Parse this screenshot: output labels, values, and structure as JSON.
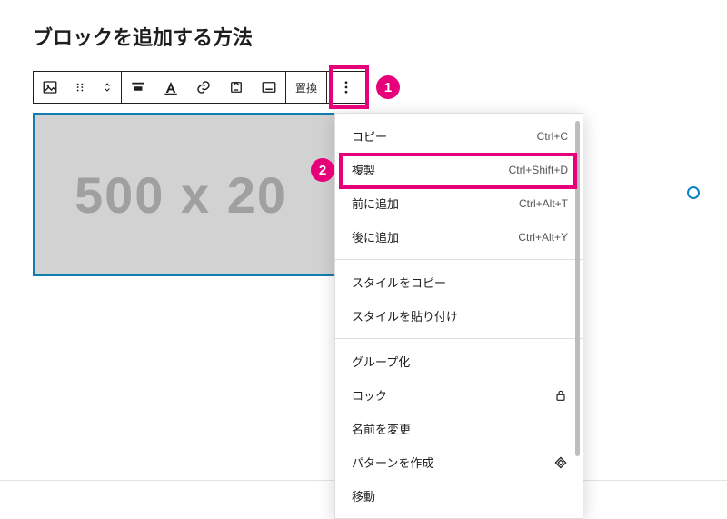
{
  "heading": "ブロックを追加する方法",
  "toolbar": {
    "replace_label": "置換"
  },
  "image_placeholder": "500 x 20",
  "callouts": {
    "one": "1",
    "two": "2"
  },
  "menu": {
    "group1": [
      {
        "label": "コピー",
        "shortcut": "Ctrl+C"
      },
      {
        "label": "複製",
        "shortcut": "Ctrl+Shift+D"
      },
      {
        "label": "前に追加",
        "shortcut": "Ctrl+Alt+T"
      },
      {
        "label": "後に追加",
        "shortcut": "Ctrl+Alt+Y"
      }
    ],
    "group2": [
      {
        "label": "スタイルをコピー",
        "shortcut": ""
      },
      {
        "label": "スタイルを貼り付け",
        "shortcut": ""
      }
    ],
    "group3": [
      {
        "label": "グループ化",
        "shortcut": ""
      },
      {
        "label": "ロック",
        "shortcut": "",
        "icon": "lock"
      },
      {
        "label": "名前を変更",
        "shortcut": ""
      },
      {
        "label": "パターンを作成",
        "shortcut": "",
        "icon": "diamond"
      },
      {
        "label": "移動",
        "shortcut": ""
      }
    ]
  }
}
